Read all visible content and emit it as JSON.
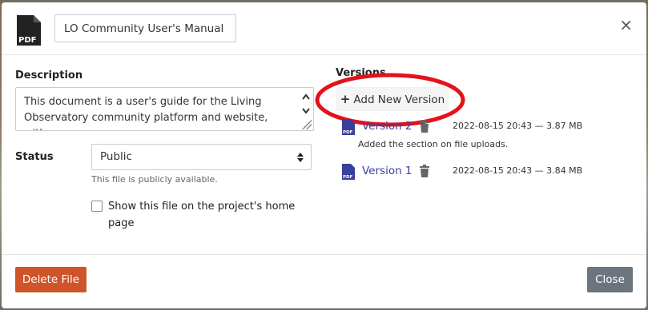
{
  "header": {
    "file_icon": "pdf-file-icon",
    "title_value": "LO Community User's Manual",
    "close_icon": "close-icon",
    "close_glyph": "×"
  },
  "description": {
    "label": "Description",
    "text": "This document is a user's guide for the Living Observatory community platform and website, with"
  },
  "status": {
    "label": "Status",
    "selected": "Public",
    "help": "This file is publicly available."
  },
  "home_page_option": {
    "label": "Show this file on the project's home page",
    "checked": false
  },
  "versions": {
    "label": "Versions",
    "add_button": "Add New Version",
    "add_icon": "+",
    "highlight_color": "#e3121b",
    "items": [
      {
        "name": "Version 2",
        "meta": "2022-08-15 20:43 — 3.87 MB",
        "note": "Added the section on file uploads."
      },
      {
        "name": "Version 1",
        "meta": "2022-08-15 20:43 — 3.84 MB",
        "note": ""
      }
    ]
  },
  "footer": {
    "delete_label": "Delete File",
    "close_label": "Close"
  },
  "colors": {
    "delete": "#d0542a",
    "close": "#6c757d",
    "link": "#3a3f9c"
  }
}
